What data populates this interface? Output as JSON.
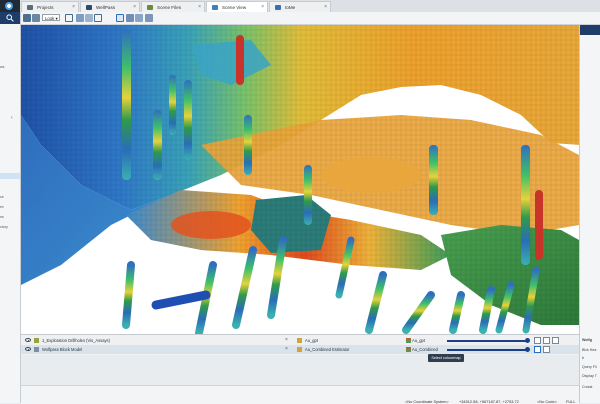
{
  "tabs": [
    {
      "label": "Projects",
      "color": "#5a6b7c"
    },
    {
      "label": "WellPass",
      "color": "#2a4a6e"
    },
    {
      "label": "Scene Files",
      "color": "#6a8c3a"
    },
    {
      "label": "Scene View",
      "color": "#3f7fbf",
      "active": true
    },
    {
      "label": "toMe",
      "color": "#3a70b0"
    }
  ],
  "toolbar": {
    "look_label": "Look"
  },
  "sidebar": {
    "fragments": [
      "ws",
      "ce",
      "ex",
      "ns",
      "ctory"
    ]
  },
  "right_panel": {
    "fragments": [
      "Wolfg",
      "Blck Hea",
      "tr",
      "Query Fil",
      "Display T",
      "Crosst"
    ]
  },
  "layers": [
    {
      "name": "1_Exploration Drillholes (Vis_Assays)",
      "table": "Au_gpt",
      "estimate_label": "Au_gpt",
      "selected": false
    },
    {
      "name": "Wolfpass Block Model",
      "table": "Au_Combined Estimator",
      "estimate_label": "Au_Combined",
      "selected": true
    }
  ],
  "tooltip": "Select colourmap",
  "status": {
    "coord_system": "<No Coordinate System>",
    "position": "+34512.58, +567187.87, +2753.72",
    "code": "<No Code>",
    "view": "FULL"
  },
  "colors": {
    "selected_row": "#dbe3ea",
    "accent": "#1d3f86"
  }
}
